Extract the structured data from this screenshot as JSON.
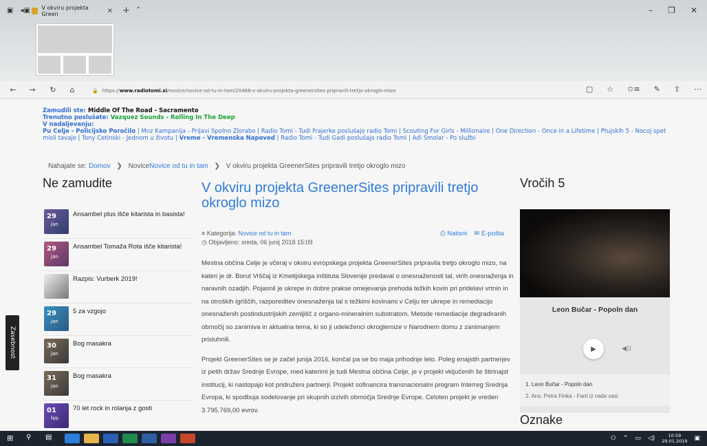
{
  "browser": {
    "tab_title": "V okviru projekta Green",
    "tab_close": "✕",
    "new_tab": "+",
    "tab_chevron": "⌃",
    "window_controls": {
      "minimize": "–",
      "restore": "❐",
      "close": "✕"
    },
    "nav": {
      "back": "←",
      "forward": "→",
      "refresh": "↻",
      "home": "⌂"
    },
    "url_prefix": "https://",
    "url_domain": "www.radiotomi.si",
    "url_path": "/novice/novice-od-tu-in-tam/20468-v-okviru-projekta-greenersites-pripravili-tretjo-okroglo-mizo",
    "right_icons": [
      "reading",
      "favorite",
      "favorites-hub",
      "notes",
      "share",
      "more"
    ]
  },
  "ticker": {
    "missed_label": "Zamudili ste:",
    "missed_value": "Middle Of The Road - Sacramento",
    "now_label": "Trenutno poslušate:",
    "now_value": "Vazquez Sounds - Rolling In The Deep",
    "next_label": "V nadaljevanju:",
    "next_segments": [
      {
        "text": "Pu Celje - Policijsko Poročilo",
        "bold": true
      },
      {
        "text": " | Mnz Kampanija - Prijavi Spolno Zlorabo | Radio Tomi - Tudi Frajerke poslušajo radio Tomi | Scouting For Girls - Millionaire | One Direction - Once in a Lifetime | Ptujskih 5 - Nocoj spet misli tavajo | Tony Cetinski - Jednom u životu | ",
        "bold": false
      },
      {
        "text": "Vreme - Vremenska Napoved",
        "bold": true
      },
      {
        "text": " | Radio Tomi - Tudi Gadi poslušajo radio Tomi | Adi Smolar - Po službi",
        "bold": false
      }
    ]
  },
  "breadcrumb": {
    "prefix": "Nahajate se:",
    "home": "Domov",
    "section": "Novice",
    "subsection": "Novice od tu in tam",
    "current": "V okviru projekta GreenerSites pripravili tretjo okroglo mizo"
  },
  "left": {
    "title": "Ne zamudite",
    "items": [
      {
        "label": "Ansambel plus išče kitarista in basista!",
        "day": "29",
        "month": "jan"
      },
      {
        "label": "Ansambel Tomaža Rota išče kitarista!",
        "day": "29",
        "month": "jan"
      },
      {
        "label": "Razpis: Vurberk 2019!",
        "day": "",
        "month": ""
      },
      {
        "label": "5 za vzgojo",
        "day": "29",
        "month": "jan"
      },
      {
        "label": "Bog masakra",
        "day": "30",
        "month": "jan"
      },
      {
        "label": "Bog masakra",
        "day": "31",
        "month": "jan"
      },
      {
        "label": "70 let rock in rolanja z gosti",
        "day": "01",
        "month": "feb"
      }
    ]
  },
  "article": {
    "title": "V okviru projekta GreenerSites pripravili tretjo okroglo mizo",
    "category_label": "Kategorija:",
    "category_value": "Novice od tu in tam",
    "published": "Objavljeno: sreda, 06 junij 2018 15:09",
    "print": "Natisni",
    "email": "E-pošta",
    "paragraphs": [
      "Mestna občina Celje je včeraj v okviru evropskega projekta GreenerSites pripravila tretjo okroglo mizo, na kateri je dr. Borut Vrščaj iz Kmetijskega inštituta Slovenije predaval o onesnaženosti tal, virih onesnaženja in naravnih ozadjih. Pojasnil je ukrepe in dobre prakse omejevanja prehoda težkih kovin pri pridelavi vrtnin in na otroških igriščih, razporeditev onesnaženja tal s težkimi kovinami v Celju ter ukrepe in remediacijo onesnaženih postindustrijskih zemljišč z organo-mineralnim substratom. Metode remediacije degradiranih območij so zanimiva in aktualna tema, ki so ji udeleženci okroglemize v Narodnem domu z zanimanjem prisluhnili.",
      "Projekt GreenerSites se je začel junija 2016, končal pa se bo maja prihodnje leto. Poleg enajstih partnerjev iz petih držav Srednje Evrope, med katerimi je tudi Mestna občina Celje, je v projekt vključenih še štirinajst institucij, ki nastopajo kot pridruženi partnerji. Projekt sofinancira transnacionalni program Interreg Srednja Evropa, ki spodbuja sodelovanje pri skupnih izzivih območja Srednje Evrope. Celoten projekt je vreden 3.795.769,00 evrov."
    ]
  },
  "right": {
    "title": "Vročih 5",
    "now_playing": "Leon Bučar - Popoln dan",
    "play_symbol": "▶",
    "volume_symbol": "◀))",
    "playlist": [
      "1. Leon Bučar - Popoln dan",
      "2. Ans. Petra Finka - Fant iz naše vasi"
    ],
    "tags_title": "Oznake"
  },
  "side_tab": "Zasebnost",
  "taskbar": {
    "time": "10:59",
    "date": "29.01.2019"
  },
  "colors": {
    "link": "#2f7bd8",
    "now_playing_green": "#1aa337",
    "ticker_blue": "#2f6fcf"
  }
}
